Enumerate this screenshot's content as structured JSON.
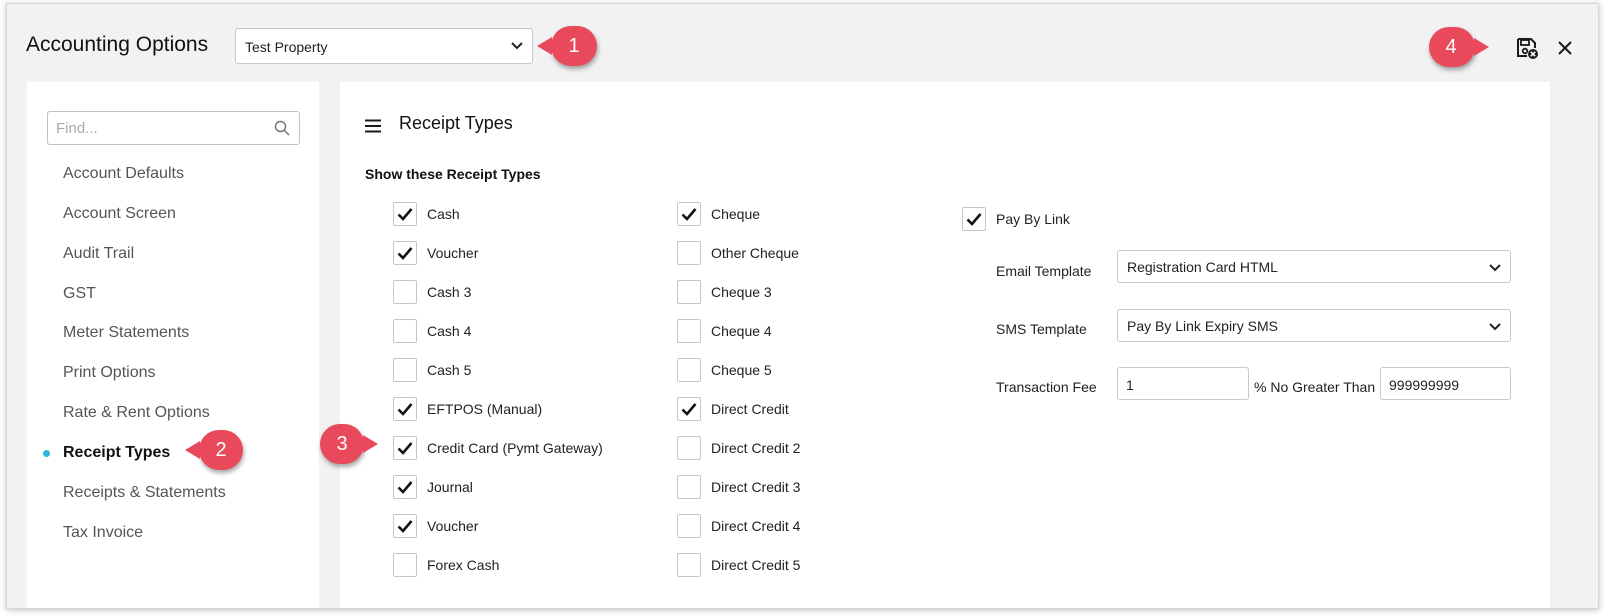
{
  "window": {
    "title": "Accounting Options",
    "property_select": {
      "value": "Test Property"
    }
  },
  "callouts": [
    "1",
    "2",
    "3",
    "4"
  ],
  "sidebar": {
    "search_placeholder": "Find...",
    "items": [
      {
        "label": "Account Defaults"
      },
      {
        "label": "Account Screen"
      },
      {
        "label": "Audit Trail"
      },
      {
        "label": "GST"
      },
      {
        "label": "Meter Statements"
      },
      {
        "label": "Print Options"
      },
      {
        "label": "Rate & Rent Options"
      },
      {
        "label": "Receipt Types",
        "active": true
      },
      {
        "label": "Receipts & Statements"
      },
      {
        "label": "Tax Invoice"
      }
    ]
  },
  "panel": {
    "title": "Receipt Types",
    "group_label": "Show these Receipt Types",
    "column1": [
      {
        "label": "Cash",
        "checked": true
      },
      {
        "label": "Voucher",
        "checked": true
      },
      {
        "label": "Cash 3",
        "checked": false
      },
      {
        "label": "Cash 4",
        "checked": false
      },
      {
        "label": "Cash 5",
        "checked": false
      },
      {
        "label": "EFTPOS (Manual)",
        "checked": true
      },
      {
        "label": "Credit Card (Pymt Gateway)",
        "checked": true
      },
      {
        "label": "Journal",
        "checked": true
      },
      {
        "label": "Voucher",
        "checked": true
      },
      {
        "label": "Forex Cash",
        "checked": false
      }
    ],
    "column2": [
      {
        "label": "Cheque",
        "checked": true
      },
      {
        "label": "Other Cheque",
        "checked": false
      },
      {
        "label": "Cheque 3",
        "checked": false
      },
      {
        "label": "Cheque 4",
        "checked": false
      },
      {
        "label": "Cheque 5",
        "checked": false
      },
      {
        "label": "Direct Credit",
        "checked": true
      },
      {
        "label": "Direct Credit 2",
        "checked": false
      },
      {
        "label": "Direct Credit 3",
        "checked": false
      },
      {
        "label": "Direct Credit 4",
        "checked": false
      },
      {
        "label": "Direct Credit 5",
        "checked": false
      }
    ],
    "pay_by_link": {
      "label": "Pay By Link",
      "checked": true,
      "email_template_label": "Email Template",
      "email_template_value": "Registration Card HTML",
      "sms_template_label": "SMS Template",
      "sms_template_value": "Pay By Link Expiry SMS",
      "transaction_fee_label": "Transaction Fee",
      "transaction_fee_value": "1",
      "no_greater_than_label": "% No Greater Than",
      "no_greater_than_value": "999999999"
    }
  },
  "icons": {
    "save": "save-disk-icon",
    "close": "close-icon",
    "search": "search-icon",
    "menu": "hamburger-menu-icon"
  },
  "colors": {
    "callout": "#e8495b",
    "active_dot": "#2fb6d6"
  }
}
